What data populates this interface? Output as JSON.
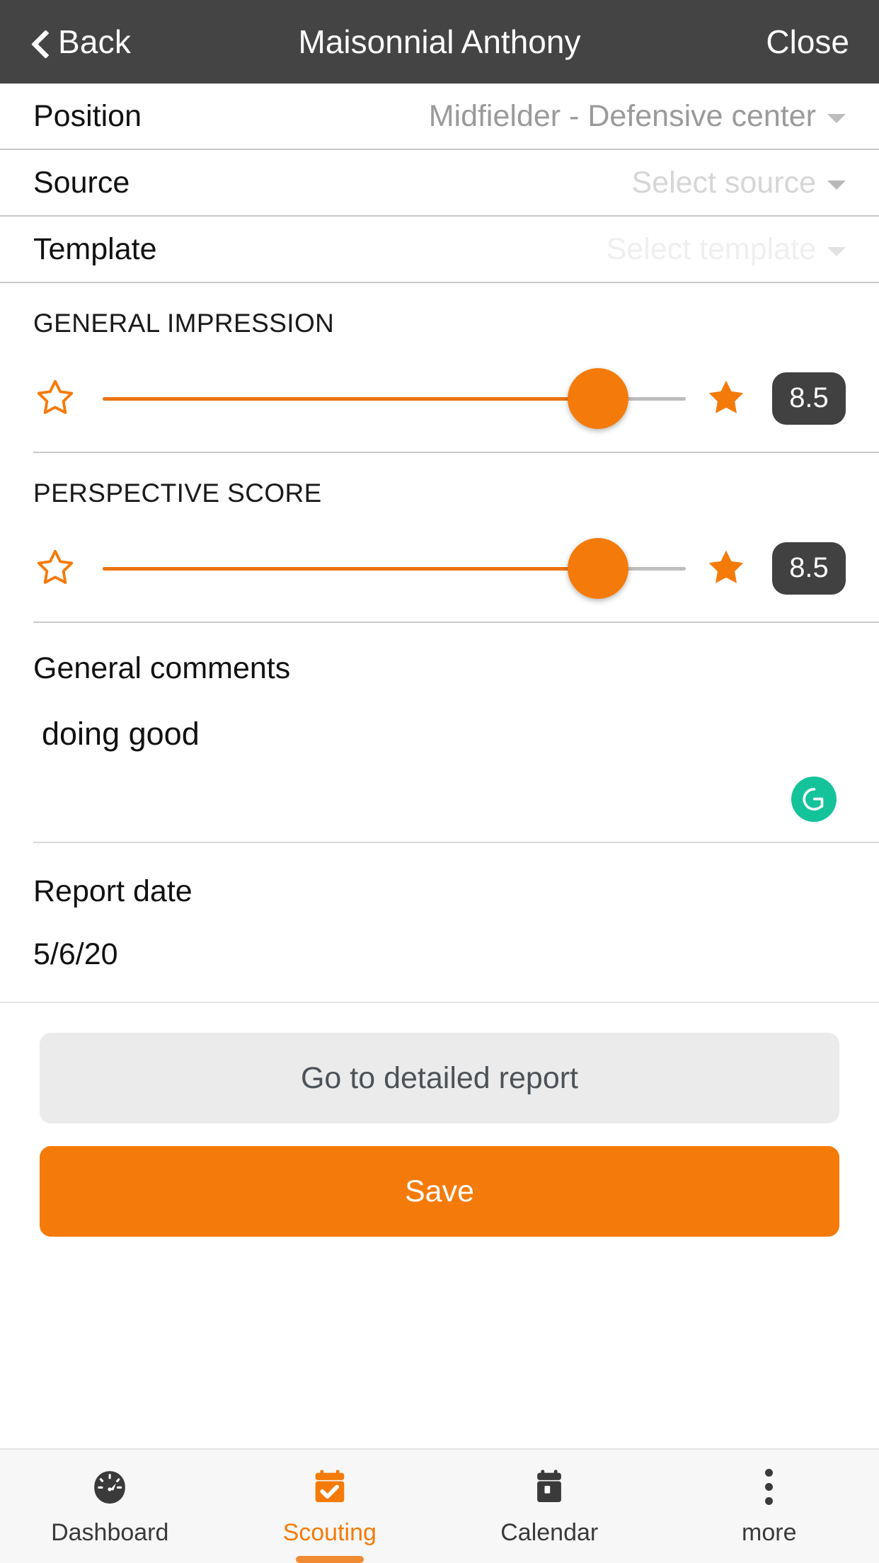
{
  "header": {
    "back_label": "Back",
    "title": "Maisonnial Anthony",
    "close_label": "Close"
  },
  "form": {
    "rows": [
      {
        "label": "Position",
        "value": "Midfielder - Defensive center",
        "state": "filled"
      },
      {
        "label": "Source",
        "value": "Select source",
        "state": "placeholder"
      },
      {
        "label": "Template",
        "value": "Select template",
        "state": "placeholder-faint"
      }
    ]
  },
  "ratings": [
    {
      "title": "GENERAL IMPRESSION",
      "score": "8.5",
      "percent": 85,
      "min_icon": "star-outline-icon",
      "max_icon": "star-filled-icon"
    },
    {
      "title": "PERSPECTIVE SCORE",
      "score": "8.5",
      "percent": 85,
      "min_icon": "star-outline-icon",
      "max_icon": "star-filled-icon"
    }
  ],
  "comments": {
    "label": "General comments",
    "value": "doing good",
    "assistant_icon": "grammarly-icon"
  },
  "report_date": {
    "label": "Report date",
    "value": "5/6/20"
  },
  "actions": {
    "detailed_report_label": "Go to detailed report",
    "save_label": "Save"
  },
  "tabbar": {
    "items": [
      {
        "label": "Dashboard",
        "icon": "speedometer-icon",
        "active": false
      },
      {
        "label": "Scouting",
        "icon": "calendar-check-icon",
        "active": true
      },
      {
        "label": "Calendar",
        "icon": "calendar-icon",
        "active": false
      },
      {
        "label": "more",
        "icon": "overflow-dots-icon",
        "active": false
      }
    ]
  },
  "colors": {
    "accent": "#f47b0a",
    "header_bg": "#444444",
    "badge_bg": "#414141",
    "grammarly_green": "#15c39a",
    "track_inactive": "#bdbdbd"
  }
}
